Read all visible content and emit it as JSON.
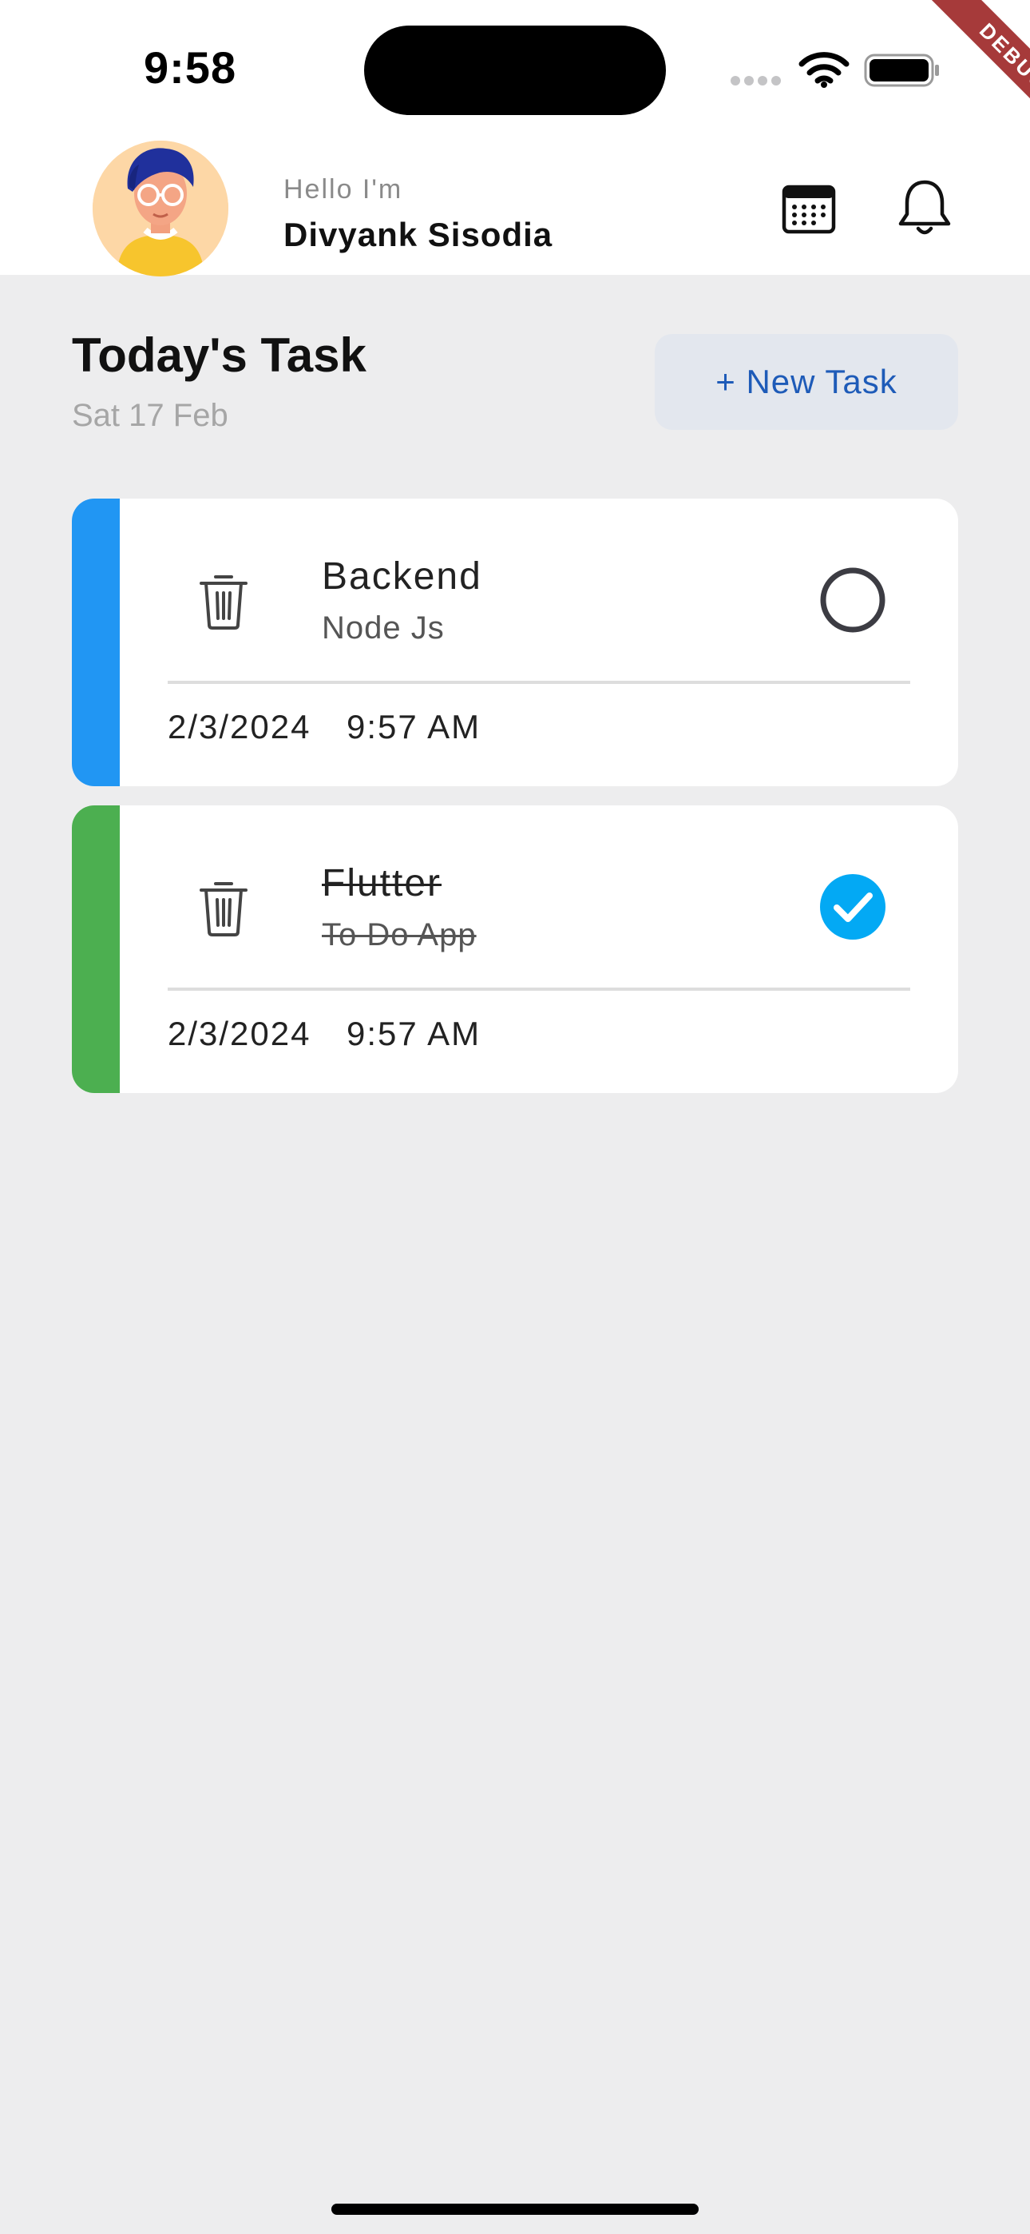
{
  "status_bar": {
    "time": "9:58",
    "debug_label": "DEBUG"
  },
  "header": {
    "greeting": "Hello I'm",
    "user_name": "Divyank Sisodia",
    "icons": [
      "calendar-icon",
      "bell-icon"
    ]
  },
  "main": {
    "title": "Today's Task",
    "date": "Sat 17 Feb",
    "new_task_label": "+ New Task"
  },
  "tasks": [
    {
      "title": "Backend",
      "subtitle": "Node Js",
      "date": "2/3/2024",
      "time": "9:57 AM",
      "completed": false,
      "accent_color": "#2196f3"
    },
    {
      "title": "Flutter",
      "subtitle": "To Do App",
      "date": "2/3/2024",
      "time": "9:57 AM",
      "completed": true,
      "accent_color": "#4caf50"
    }
  ],
  "colors": {
    "check_blue": "#03a9f4",
    "button_text": "#1e5bb8"
  }
}
